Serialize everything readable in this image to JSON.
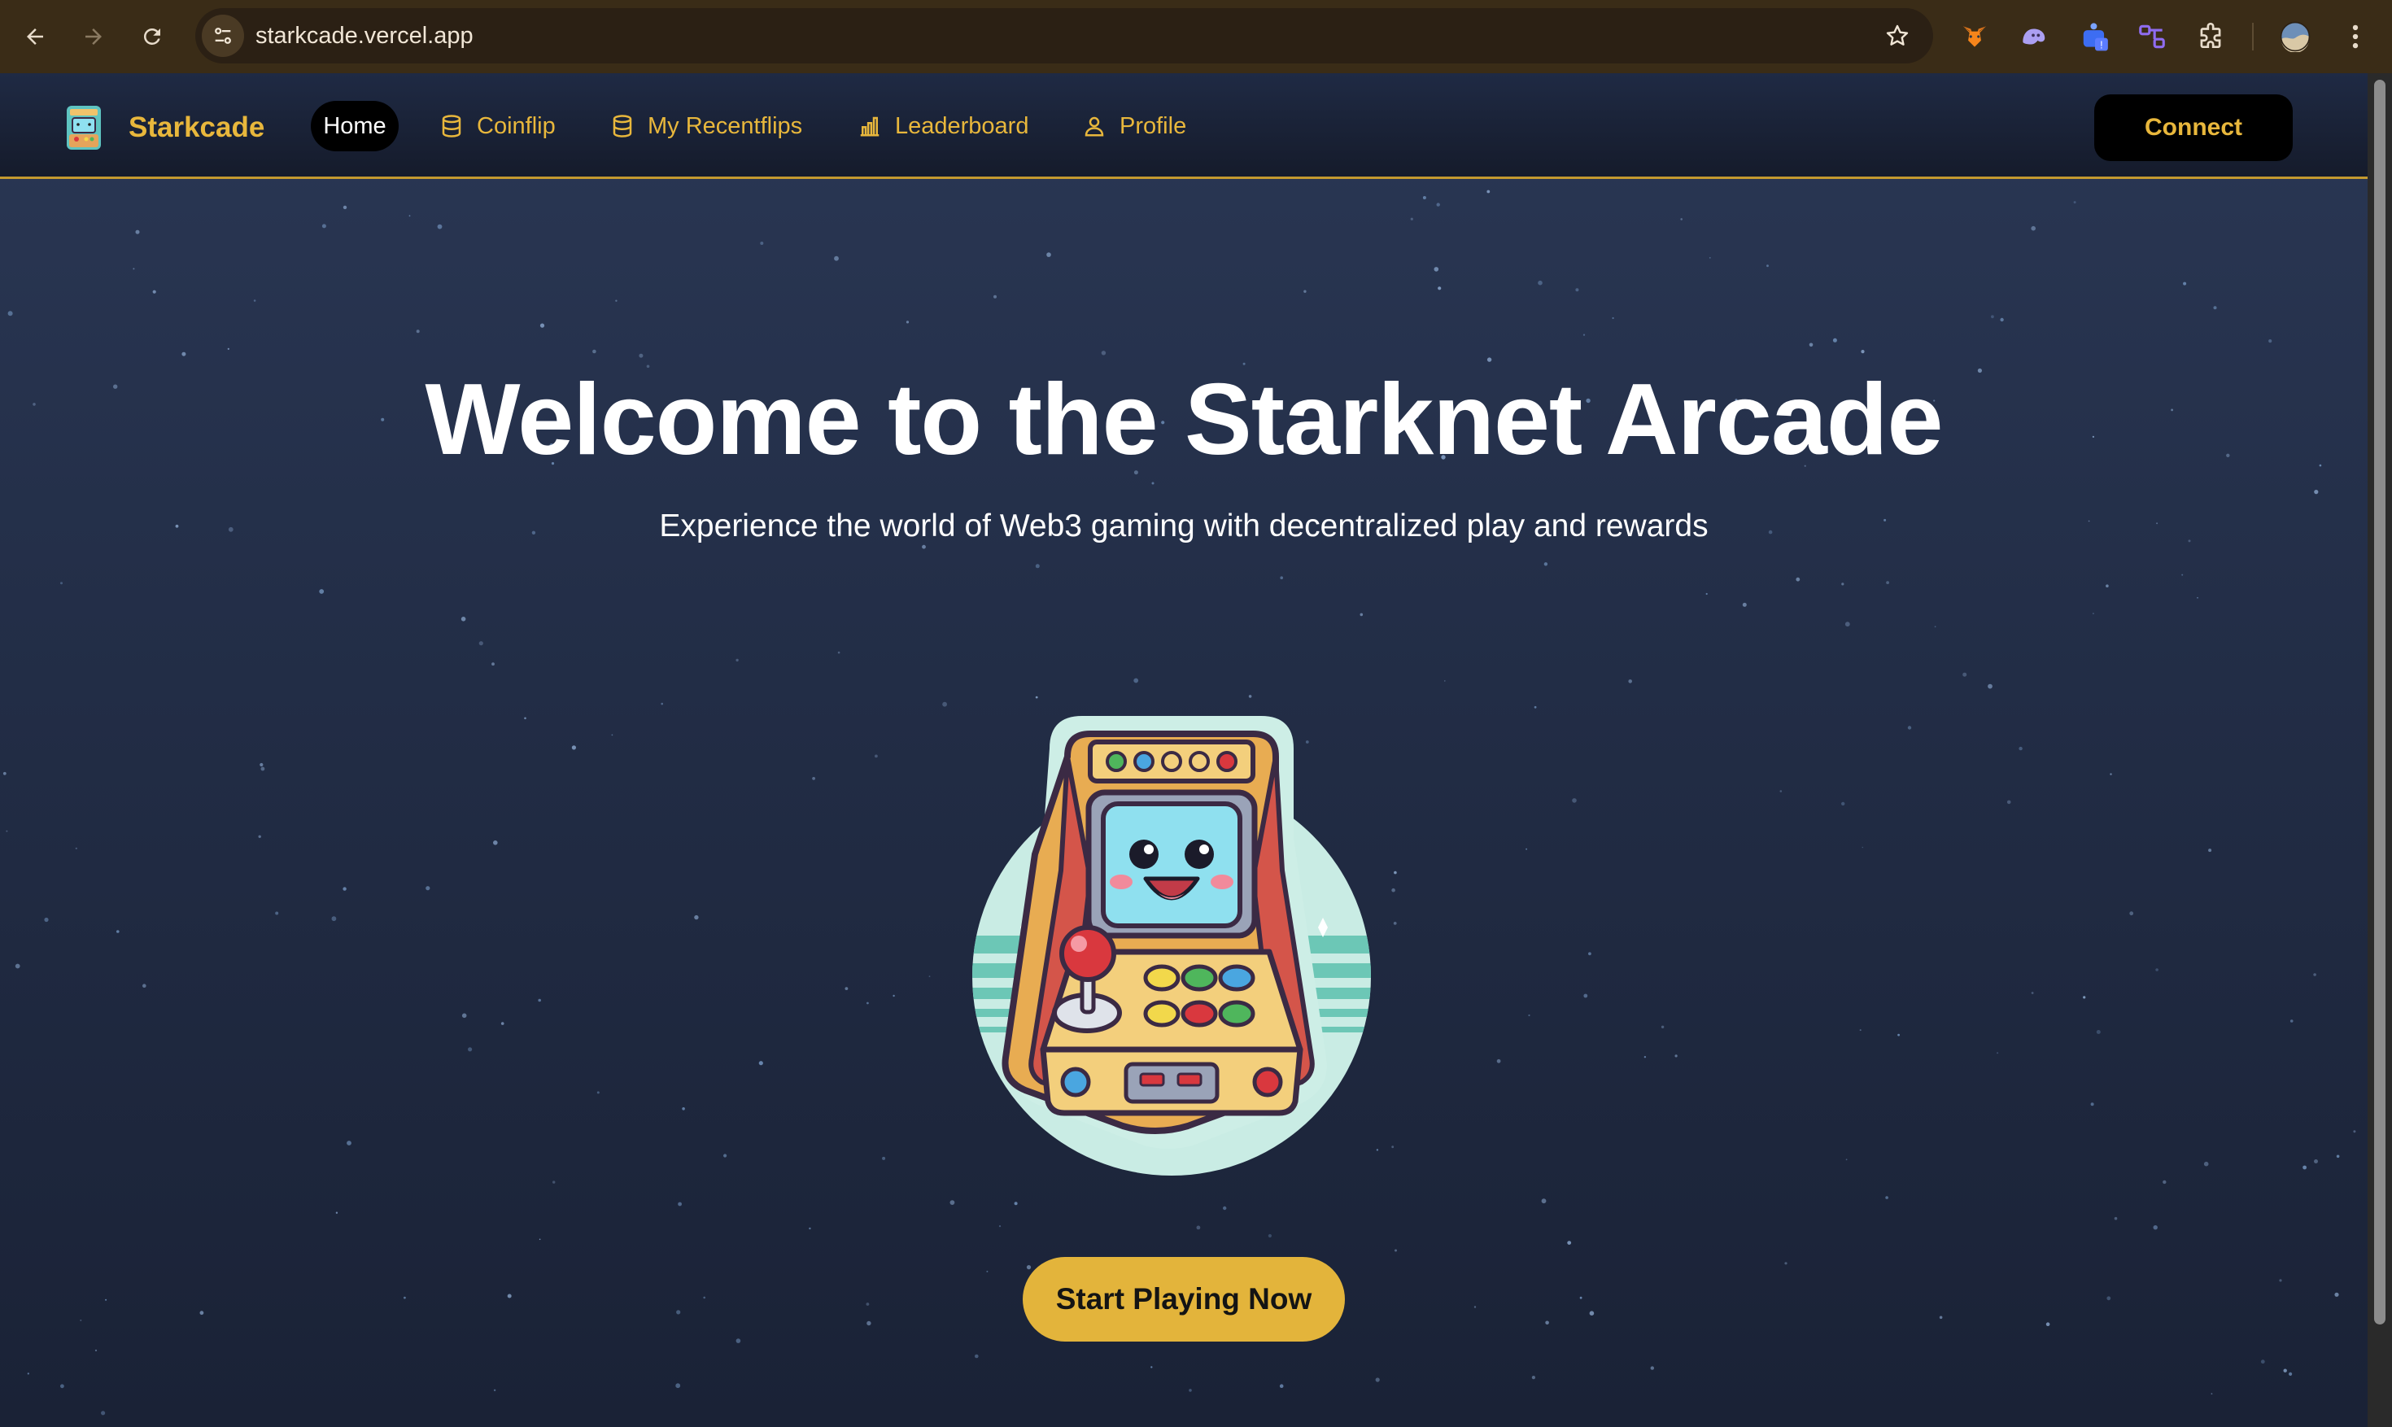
{
  "browser": {
    "url": "starkcade.vercel.app",
    "icons": {
      "back": "back-arrow-icon",
      "forward": "forward-arrow-icon",
      "reload": "reload-icon",
      "site_info": "tune-icon",
      "bookmark": "star-icon",
      "menu": "more-vert-icon"
    },
    "extensions": [
      "metamask-fox-icon",
      "ghost-wallet-icon",
      "wallet-badge-icon",
      "network-extension-icon",
      "puzzle-extensions-icon",
      "profile-avatar"
    ]
  },
  "navbar": {
    "brand": "Starkcade",
    "items": [
      {
        "label": "Home",
        "active": true
      },
      {
        "label": "Coinflip",
        "icon": "database-icon"
      },
      {
        "label": "My Recentflips",
        "icon": "database-icon"
      },
      {
        "label": "Leaderboard",
        "icon": "bar-chart-icon"
      },
      {
        "label": "Profile",
        "icon": "user-icon"
      }
    ],
    "connect_label": "Connect"
  },
  "hero": {
    "title": "Welcome to the Starknet Arcade",
    "subtitle": "Experience the world of Web3 gaming with decentralized play and rewards",
    "cta_label": "Start Playing Now"
  },
  "colors": {
    "accent": "#e3b43b",
    "nav_gold": "#e8b73c",
    "page_bg_top": "#2a3754",
    "page_bg_bottom": "#1a2236",
    "chrome_bg": "#3a2c17"
  }
}
